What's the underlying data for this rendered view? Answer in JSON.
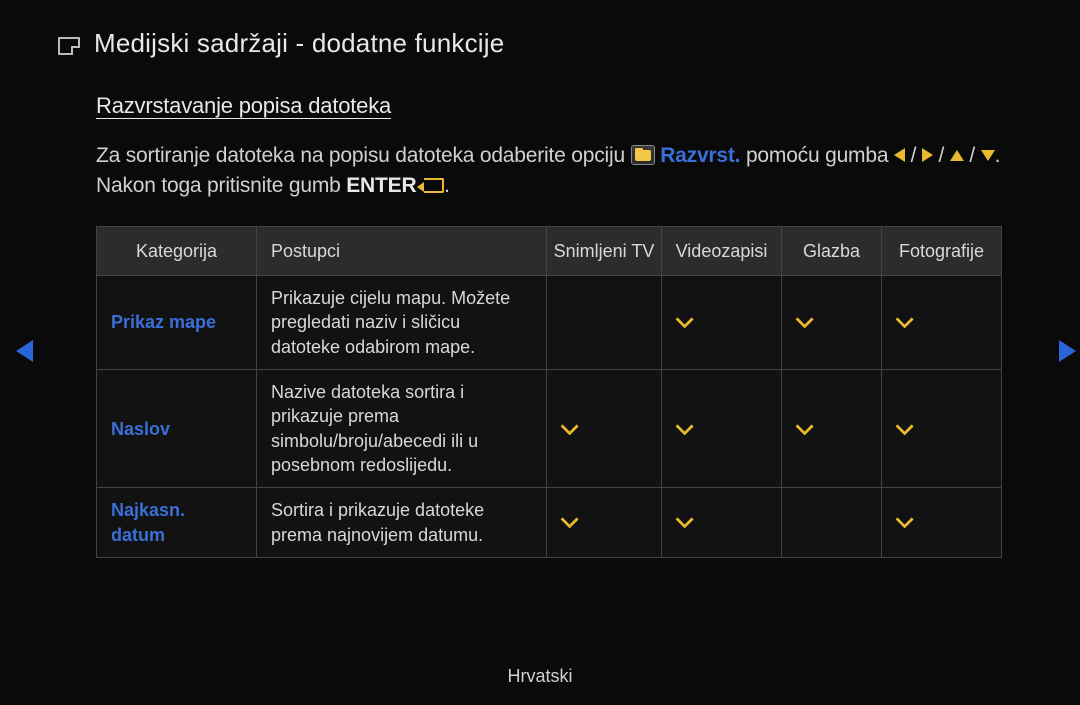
{
  "title": "Medijski sadržaji - dodatne funkcije",
  "subhead": "Razvrstavanje popisa datoteka",
  "desc": {
    "part1": "Za sortiranje datoteka na popisu datoteka odaberite opciju ",
    "razvrst": "Razvrst.",
    "part2": " pomoću gumba ",
    "slash": " / ",
    "part3": ". Nakon toga pritisnite gumb ",
    "enter": "ENTER",
    "period": "."
  },
  "table": {
    "headers": [
      "Kategorija",
      "Postupci",
      "Snimljeni TV",
      "Videozapisi",
      "Glazba",
      "Fotografije"
    ],
    "rows": [
      {
        "cat": "Prikaz mape",
        "desc": "Prikazuje cijelu mapu. Možete pregledati naziv i sličicu datoteke odabirom mape.",
        "chk": [
          false,
          true,
          true,
          true
        ]
      },
      {
        "cat": "Naslov",
        "desc": "Nazive datoteka sortira i prikazuje prema simbolu/broju/abecedi ili u posebnom redoslijedu.",
        "chk": [
          true,
          true,
          true,
          true
        ]
      },
      {
        "cat": "Najkasn. datum",
        "desc": "Sortira i prikazuje datoteke prema najnovijem datumu.",
        "chk": [
          true,
          true,
          false,
          true
        ]
      }
    ]
  },
  "footer": "Hrvatski"
}
